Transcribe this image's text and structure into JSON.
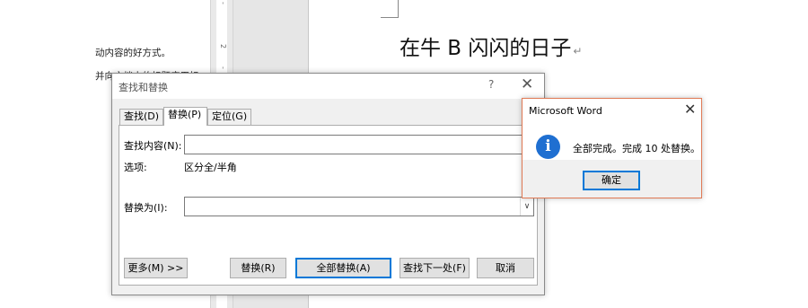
{
  "document": {
    "left_text_lines": [
      "动内容的好方式。",
      "并向文档中的标题应用标"
    ],
    "ruler_ticks": [
      "-",
      "2",
      "-"
    ],
    "heading": "在牛 B 闪闪的日子",
    "pilcrow": "↵"
  },
  "find_replace": {
    "title": "查找和替换",
    "help_glyph": "?",
    "close_glyph": "✕",
    "tabs": [
      "查找(D)",
      "替换(P)",
      "定位(G)"
    ],
    "active_tab": "替换(P)",
    "find_label": "查找内容(N):",
    "find_value": "",
    "options_label": "选项:",
    "options_value": "区分全/半角",
    "replace_label": "替换为(I):",
    "replace_value": "",
    "dropdown_glyph": "∨",
    "buttons": {
      "more": "更多(M) >>",
      "replace": "替换(R)",
      "replace_all": "全部替换(A)",
      "find_next": "查找下一处(F)",
      "cancel": "取消"
    }
  },
  "message_box": {
    "title": "Microsoft Word",
    "close_glyph": "✕",
    "icon": "info-icon",
    "icon_glyph": "i",
    "message": "全部完成。完成 10 处替换。",
    "ok_label": "确定",
    "accent_color": "#1f6fd1"
  }
}
